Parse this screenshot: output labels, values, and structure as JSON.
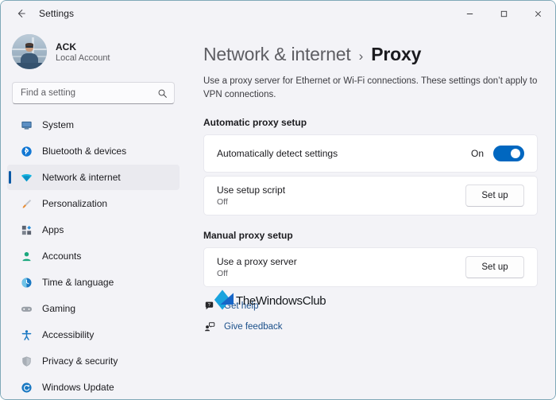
{
  "window": {
    "app_title": "Settings",
    "back_icon": "back-arrow-icon",
    "minimize_label": "—",
    "maximize_label": "□",
    "close_label": "✕"
  },
  "sidebar": {
    "account": {
      "name": "ACK",
      "subtitle": "Local Account",
      "avatar_icon": "user-avatar-photo"
    },
    "search": {
      "placeholder": "Find a setting",
      "value": "",
      "icon": "search-icon"
    },
    "items": [
      {
        "label": "System",
        "icon": "monitor-icon",
        "active": false
      },
      {
        "label": "Bluetooth & devices",
        "icon": "bluetooth-icon",
        "active": false
      },
      {
        "label": "Network & internet",
        "icon": "wifi-icon",
        "active": true
      },
      {
        "label": "Personalization",
        "icon": "paintbrush-icon",
        "active": false
      },
      {
        "label": "Apps",
        "icon": "apps-grid-icon",
        "active": false
      },
      {
        "label": "Accounts",
        "icon": "person-icon",
        "active": false
      },
      {
        "label": "Time & language",
        "icon": "clock-globe-icon",
        "active": false
      },
      {
        "label": "Gaming",
        "icon": "gamepad-icon",
        "active": false
      },
      {
        "label": "Accessibility",
        "icon": "accessibility-person-icon",
        "active": false
      },
      {
        "label": "Privacy & security",
        "icon": "shield-icon",
        "active": false
      },
      {
        "label": "Windows Update",
        "icon": "refresh-circle-icon",
        "active": false
      }
    ]
  },
  "main": {
    "breadcrumb": {
      "parent": "Network & internet",
      "separator": "›",
      "current": "Proxy"
    },
    "description": "Use a proxy server for Ethernet or Wi-Fi connections. These settings don’t apply to VPN connections.",
    "sections": [
      {
        "title": "Automatic proxy setup",
        "rows": [
          {
            "label": "Automatically detect settings",
            "sub": "",
            "control": "toggle",
            "state_text": "On",
            "toggle_on": true
          },
          {
            "label": "Use setup script",
            "sub": "Off",
            "control": "button",
            "button_label": "Set up"
          }
        ]
      },
      {
        "title": "Manual proxy setup",
        "rows": [
          {
            "label": "Use a proxy server",
            "sub": "Off",
            "control": "button",
            "button_label": "Set up"
          }
        ]
      }
    ],
    "links": [
      {
        "label": "Get help",
        "icon": "question-bubble-icon"
      },
      {
        "label": "Give feedback",
        "icon": "feedback-person-icon"
      }
    ],
    "watermark": {
      "text": "TheWindowsClub",
      "icon": "thewindowsclub-logo-icon"
    }
  },
  "colors": {
    "accent": "#0067C0",
    "selection_bar": "#0B5AA6",
    "link": "#1A4F8A",
    "background": "#F3F3F7",
    "card": "#FFFFFF"
  }
}
